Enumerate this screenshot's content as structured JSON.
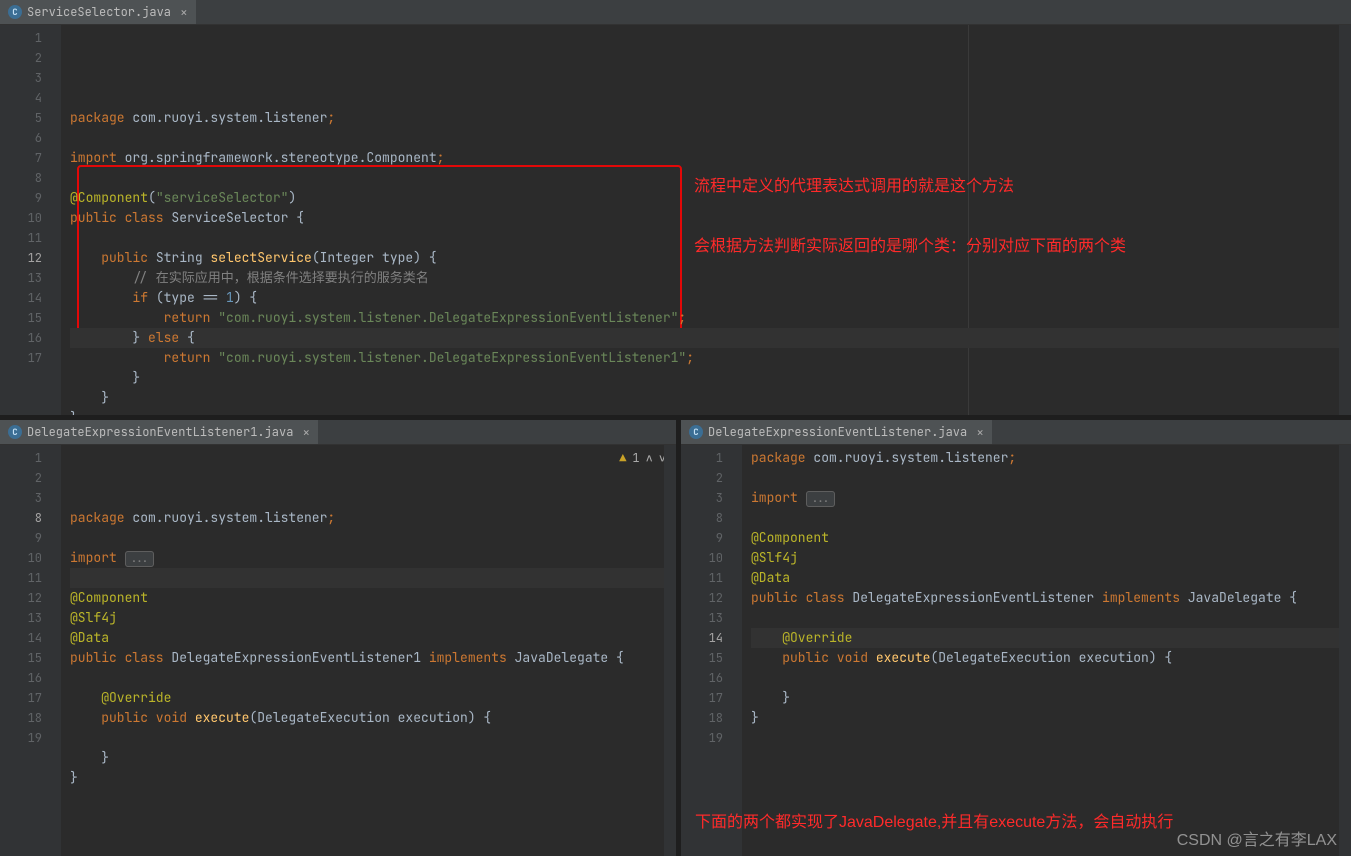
{
  "watermark_top": "CSDN @言之有李LAX",
  "watermark_bot": "CSDN @言之有李LAX",
  "annotations": {
    "a1": "流程中定义的代理表达式调用的就是这个方法",
    "a2": "会根据方法判断实际返回的是哪个类：分别对应下面的两个类",
    "a3": "下面的两个都实现了JavaDelegate,并且有execute方法，会自动执行"
  },
  "top": {
    "tab": "ServiceSelector.java",
    "warning": "",
    "lines": [
      {
        "n": "1",
        "t": [
          [
            "kw",
            "package "
          ],
          [
            "cls",
            "com.ruoyi.system.listener"
          ],
          [
            "semi",
            ";"
          ]
        ]
      },
      {
        "n": "2",
        "t": []
      },
      {
        "n": "3",
        "t": [
          [
            "kw",
            "import "
          ],
          [
            "cls",
            "org.springframework.stereotype."
          ],
          [
            "cls",
            "Component"
          ],
          [
            "semi",
            ";"
          ]
        ]
      },
      {
        "n": "4",
        "t": []
      },
      {
        "n": "5",
        "t": [
          [
            "ann",
            "@Component"
          ],
          [
            "",
            "("
          ],
          [
            "str",
            "\"serviceSelector\""
          ],
          [
            "",
            ")"
          ]
        ]
      },
      {
        "n": "6",
        "t": [
          [
            "kw",
            "public class "
          ],
          [
            "cls",
            "ServiceSelector "
          ],
          [
            "",
            "{"
          ]
        ]
      },
      {
        "n": "7",
        "t": []
      },
      {
        "n": "8",
        "t": [
          [
            "",
            "    "
          ],
          [
            "kw",
            "public "
          ],
          [
            "cls",
            "String "
          ],
          [
            "fn",
            "selectService"
          ],
          [
            "",
            "(Integer type) {"
          ]
        ]
      },
      {
        "n": "9",
        "t": [
          [
            "",
            "        "
          ],
          [
            "com",
            "// 在实际应用中，根据条件选择要执行的服务类名"
          ]
        ]
      },
      {
        "n": "10",
        "t": [
          [
            "",
            "        "
          ],
          [
            "kw",
            "if "
          ],
          [
            "",
            "(type == "
          ],
          [
            "num",
            "1"
          ],
          [
            "",
            ") {"
          ]
        ]
      },
      {
        "n": "11",
        "t": [
          [
            "",
            "            "
          ],
          [
            "kw",
            "return "
          ],
          [
            "str",
            "\"com.ruoyi.system.listener.DelegateExpressionEventListener\""
          ],
          [
            "semi",
            ";"
          ]
        ]
      },
      {
        "n": "12",
        "t": [
          [
            "",
            "        } "
          ],
          [
            "kw",
            "else "
          ],
          [
            "",
            "{"
          ]
        ],
        "caret": true
      },
      {
        "n": "13",
        "t": [
          [
            "",
            "            "
          ],
          [
            "kw",
            "return "
          ],
          [
            "str",
            "\"com.ruoyi.system.listener.DelegateExpressionEventListener1\""
          ],
          [
            "semi",
            ";"
          ]
        ]
      },
      {
        "n": "14",
        "t": [
          [
            "",
            "        }"
          ]
        ]
      },
      {
        "n": "15",
        "t": [
          [
            "",
            "    }"
          ]
        ]
      },
      {
        "n": "16",
        "t": [
          [
            "",
            "}"
          ]
        ]
      },
      {
        "n": "17",
        "t": []
      }
    ]
  },
  "bl": {
    "tab": "DelegateExpressionEventListener1.java",
    "warning": "1",
    "lines": [
      {
        "n": "1",
        "t": [
          [
            "kw",
            "package "
          ],
          [
            "cls",
            "com.ruoyi.system.listener"
          ],
          [
            "semi",
            ";"
          ]
        ]
      },
      {
        "n": "2",
        "t": []
      },
      {
        "n": "3",
        "t": [
          [
            "kw",
            "import "
          ],
          [
            "fold",
            "..."
          ]
        ]
      },
      {
        "n": "8",
        "t": [],
        "caret": true
      },
      {
        "n": "9",
        "t": [
          [
            "ann",
            "@Component"
          ]
        ]
      },
      {
        "n": "10",
        "t": [
          [
            "ann",
            "@Slf4j"
          ]
        ]
      },
      {
        "n": "11",
        "t": [
          [
            "ann",
            "@Data"
          ]
        ]
      },
      {
        "n": "12",
        "t": [
          [
            "kw",
            "public class "
          ],
          [
            "cls",
            "DelegateExpressionEventListener1 "
          ],
          [
            "kw",
            "implements "
          ],
          [
            "cls",
            "JavaDelegate "
          ],
          [
            "",
            "{"
          ]
        ]
      },
      {
        "n": "13",
        "t": []
      },
      {
        "n": "14",
        "t": [
          [
            "",
            "    "
          ],
          [
            "ann",
            "@Override"
          ]
        ]
      },
      {
        "n": "15",
        "t": [
          [
            "",
            "    "
          ],
          [
            "kw",
            "public void "
          ],
          [
            "fn",
            "execute"
          ],
          [
            "",
            "(DelegateExecution execution) {"
          ]
        ]
      },
      {
        "n": "16",
        "t": []
      },
      {
        "n": "17",
        "t": [
          [
            "",
            "    }"
          ]
        ]
      },
      {
        "n": "18",
        "t": [
          [
            "",
            "}"
          ]
        ]
      },
      {
        "n": "19",
        "t": []
      }
    ]
  },
  "br": {
    "tab": "DelegateExpressionEventListener.java",
    "lines": [
      {
        "n": "1",
        "t": [
          [
            "kw",
            "package "
          ],
          [
            "cls",
            "com.ruoyi.system.listener"
          ],
          [
            "semi",
            ";"
          ]
        ]
      },
      {
        "n": "2",
        "t": []
      },
      {
        "n": "3",
        "t": [
          [
            "kw",
            "import "
          ],
          [
            "fold",
            "..."
          ]
        ]
      },
      {
        "n": "8",
        "t": []
      },
      {
        "n": "9",
        "t": [
          [
            "ann",
            "@Component"
          ]
        ]
      },
      {
        "n": "10",
        "t": [
          [
            "ann",
            "@Slf4j"
          ]
        ]
      },
      {
        "n": "11",
        "t": [
          [
            "ann",
            "@Data"
          ]
        ]
      },
      {
        "n": "12",
        "t": [
          [
            "kw",
            "public class "
          ],
          [
            "cls",
            "DelegateExpressionEventListener "
          ],
          [
            "kw",
            "implements "
          ],
          [
            "cls",
            "JavaDelegate "
          ],
          [
            "",
            "{"
          ]
        ]
      },
      {
        "n": "13",
        "t": []
      },
      {
        "n": "14",
        "t": [
          [
            "",
            "    "
          ],
          [
            "ann",
            "@Override"
          ]
        ],
        "caret": true
      },
      {
        "n": "15",
        "t": [
          [
            "",
            "    "
          ],
          [
            "kw",
            "public void "
          ],
          [
            "fn",
            "execute"
          ],
          [
            "",
            "(DelegateExecution execution) {"
          ]
        ]
      },
      {
        "n": "16",
        "t": []
      },
      {
        "n": "17",
        "t": [
          [
            "",
            "    }"
          ]
        ]
      },
      {
        "n": "18",
        "t": [
          [
            "",
            "}"
          ]
        ]
      },
      {
        "n": "19",
        "t": []
      }
    ]
  }
}
